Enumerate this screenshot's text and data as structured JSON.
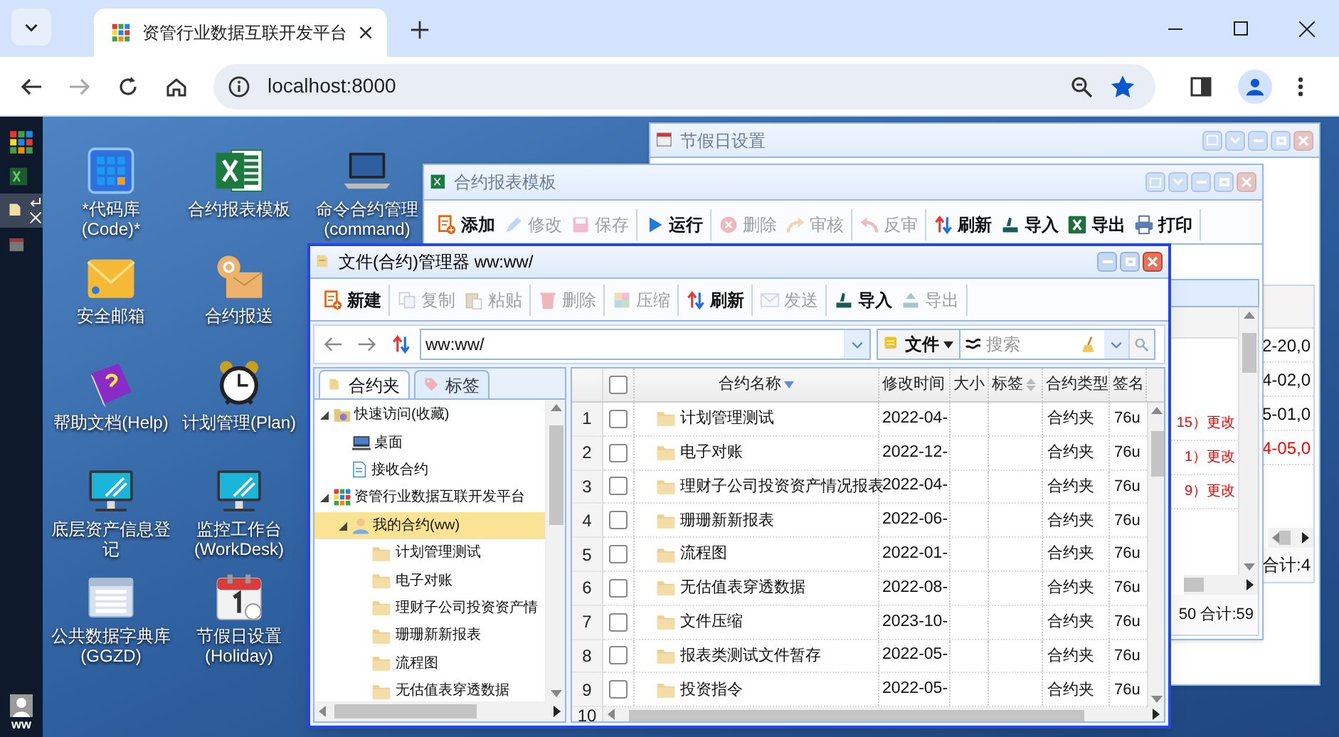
{
  "browser": {
    "tab_title": "资管行业数据互联开发平台",
    "url": "localhost:8000"
  },
  "taskbar": {
    "items": [
      {
        "selected": false
      },
      {
        "selected": false
      },
      {
        "selected": true
      },
      {
        "selected": false
      }
    ],
    "user": "ww"
  },
  "desktop_icons": [
    {
      "lines": [
        "*代码库",
        "(Code)*"
      ]
    },
    {
      "lines": [
        "安全邮箱"
      ]
    },
    {
      "lines": [
        "帮助文档(Help)"
      ]
    },
    {
      "lines": [
        "底层资产信息登",
        "记"
      ]
    },
    {
      "lines": [
        "公共数据字典库",
        "(GGZD)"
      ]
    },
    {
      "lines": [
        "合约报表模板"
      ]
    },
    {
      "lines": [
        "合约报送"
      ]
    },
    {
      "lines": [
        "计划管理(Plan)"
      ]
    },
    {
      "lines": [
        "监控工作台",
        "(WorkDesk)"
      ]
    },
    {
      "lines": [
        "节假日设置",
        "(Holiday)"
      ]
    },
    {
      "lines": [
        "命令合约管理",
        "(command)"
      ]
    }
  ],
  "holiday_window": {
    "title": "节假日设置",
    "rows": [
      {
        "text": "2-20,0",
        "alert": false
      },
      {
        "text": "4-02,0",
        "alert": false
      },
      {
        "text": "5-01,0",
        "alert": false
      },
      {
        "text": "4-05,0",
        "alert": true
      }
    ],
    "footer": "合计:4"
  },
  "report_window": {
    "title": "合约报表模板",
    "toolbar": [
      {
        "buttons": [
          {
            "label": "添加",
            "disabled": false
          },
          {
            "label": "修改",
            "disabled": true
          },
          {
            "label": "保存",
            "disabled": true
          }
        ]
      },
      {
        "buttons": [
          {
            "label": "运行",
            "disabled": false
          }
        ]
      },
      {
        "buttons": [
          {
            "label": "删除",
            "disabled": true
          },
          {
            "label": "审核",
            "disabled": true
          }
        ]
      },
      {
        "buttons": [
          {
            "label": "反审",
            "disabled": true
          }
        ]
      },
      {
        "buttons": [
          {
            "label": "刷新",
            "disabled": false
          },
          {
            "label": "导入",
            "disabled": false
          },
          {
            "label": "导出",
            "disabled": false
          },
          {
            "label": "打印",
            "disabled": false
          }
        ]
      }
    ],
    "rows": [
      {
        "text": "15）更改",
        "alert": true
      },
      {
        "text": "1）更改",
        "alert": true
      },
      {
        "text": "9）更改",
        "alert": true
      }
    ],
    "footer": "50 合计:59"
  },
  "file_manager": {
    "title": "文件(合约)管理器 ww:ww/",
    "toolbar": [
      {
        "buttons": [
          {
            "label": "新建",
            "disabled": false
          }
        ]
      },
      {
        "buttons": [
          {
            "label": "复制",
            "disabled": true
          },
          {
            "label": "粘贴",
            "disabled": true
          }
        ]
      },
      {
        "buttons": [
          {
            "label": "删除",
            "disabled": true
          }
        ]
      },
      {
        "buttons": [
          {
            "label": "压缩",
            "disabled": true
          }
        ]
      },
      {
        "buttons": [
          {
            "label": "刷新",
            "disabled": false
          }
        ]
      },
      {
        "buttons": [
          {
            "label": "发送",
            "disabled": true
          }
        ]
      },
      {
        "buttons": [
          {
            "label": "导入",
            "disabled": false
          },
          {
            "label": "导出",
            "disabled": true
          }
        ]
      }
    ],
    "path": "ww:ww/",
    "type_filter": "文件",
    "search": {
      "placeholder": "搜索"
    },
    "tabs": [
      {
        "label": "合约夹",
        "selected": true
      },
      {
        "label": "标签",
        "selected": false
      }
    ],
    "tree": [
      {
        "label": "快速访问(收藏)",
        "expanded": true,
        "selected": false,
        "children": [
          {
            "label": "桌面",
            "selected": false
          },
          {
            "label": "接收合约",
            "selected": false
          }
        ]
      },
      {
        "label": "资管行业数据互联开发平台",
        "expanded": true,
        "selected": false,
        "children": [
          {
            "label": "我的合约(ww)",
            "expanded": true,
            "selected": true,
            "children": [
              {
                "label": "计划管理测试",
                "selected": false
              },
              {
                "label": "电子对账",
                "selected": false
              },
              {
                "label": "理财子公司投资资产情",
                "selected": false
              },
              {
                "label": "珊珊新新报表",
                "selected": false
              },
              {
                "label": "流程图",
                "selected": false
              },
              {
                "label": "无估值表穿透数据",
                "selected": false
              }
            ]
          }
        ]
      }
    ],
    "table": {
      "columns": [
        "合约名称",
        "修改时间",
        "大小",
        "标签",
        "合约类型",
        "签名"
      ],
      "rows": [
        {
          "number": "1",
          "checked": false,
          "name": "计划管理测试",
          "modified": "2022-04-",
          "type": "合约夹",
          "signature": "76u"
        },
        {
          "number": "2",
          "checked": false,
          "name": "电子对账",
          "modified": "2022-12-",
          "type": "合约夹",
          "signature": "76u"
        },
        {
          "number": "3",
          "checked": false,
          "name": "理财子公司投资资产情况报表",
          "modified": "2022-04-",
          "type": "合约夹",
          "signature": "76u"
        },
        {
          "number": "4",
          "checked": false,
          "name": "珊珊新新报表",
          "modified": "2022-06-",
          "type": "合约夹",
          "signature": "76u"
        },
        {
          "number": "5",
          "checked": false,
          "name": "流程图",
          "modified": "2022-01-",
          "type": "合约夹",
          "signature": "76u"
        },
        {
          "number": "6",
          "checked": false,
          "name": "无估值表穿透数据",
          "modified": "2022-08-",
          "type": "合约夹",
          "signature": "76u"
        },
        {
          "number": "7",
          "checked": false,
          "name": "文件压缩",
          "modified": "2023-10-",
          "type": "合约夹",
          "signature": "76u"
        },
        {
          "number": "8",
          "checked": false,
          "name": "报表类测试文件暂存",
          "modified": "2022-05-",
          "type": "合约夹",
          "signature": "76u"
        },
        {
          "number": "9",
          "checked": false,
          "name": "投资指令",
          "modified": "2022-05-",
          "type": "合约夹",
          "signature": "76u"
        }
      ],
      "partial_row_number": "10",
      "select_all_checked": false
    }
  }
}
